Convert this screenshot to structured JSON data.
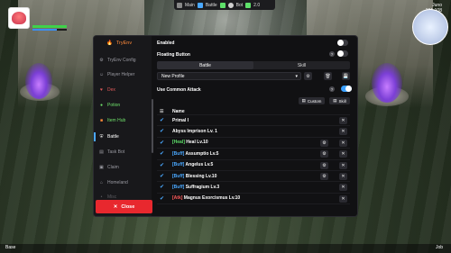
{
  "hud": {
    "top_items": [
      "Main",
      "Battle",
      "Bot",
      "2.0"
    ],
    "minimap_title": "Juno",
    "minimap_coords": "151,108",
    "bottom_left": "Base",
    "bottom_right": "Job"
  },
  "sidebar": {
    "header": "TryEnv",
    "items": [
      {
        "label": "TryEnv Config",
        "icon": "gear-icon"
      },
      {
        "label": "Player Helper",
        "icon": "user-icon"
      },
      {
        "label": "Dex",
        "icon": "dex-icon"
      },
      {
        "label": "Potion",
        "icon": "potion-icon"
      },
      {
        "label": "Item Hub",
        "icon": "box-icon"
      },
      {
        "label": "Battle",
        "icon": "shield-icon"
      },
      {
        "label": "Task Bot",
        "icon": "task-icon"
      },
      {
        "label": "Claim",
        "icon": "claim-icon"
      },
      {
        "label": "Homeland",
        "icon": "home-icon"
      },
      {
        "label": "Misc",
        "icon": "misc-icon"
      }
    ],
    "close_label": "Close"
  },
  "content": {
    "enabled_label": "Enabled",
    "floating_label": "Floating Button",
    "tabs": [
      "Battle",
      "Skill"
    ],
    "profile_select": "New Profile",
    "common_attack_label": "Use Common Attack",
    "custom_btn": "Custom",
    "skill_btn": "Skill",
    "list_header": "Name",
    "skills": [
      {
        "tag": "",
        "name": "Primal I",
        "tag_color": "",
        "gear": false
      },
      {
        "tag": "",
        "name": "Abyss Imprison Lv. 1",
        "tag_color": "",
        "gear": false
      },
      {
        "tag": "[Heal]",
        "name": " Heal Lv.10",
        "tag_color": "#5ee06a",
        "gear": true
      },
      {
        "tag": "[Buff]",
        "name": " Assumptio Lv.5",
        "tag_color": "#4aa8ff",
        "gear": true
      },
      {
        "tag": "[Buff]",
        "name": " Angelus Lv.5",
        "tag_color": "#4aa8ff",
        "gear": true
      },
      {
        "tag": "[Buff]",
        "name": " Blessing Lv.10",
        "tag_color": "#4aa8ff",
        "gear": true
      },
      {
        "tag": "[Buff]",
        "name": " Suffragium Lv.3",
        "tag_color": "#4aa8ff",
        "gear": false
      },
      {
        "tag": "[Atk]",
        "name": " Magnus Exorcismus Lv.10",
        "tag_color": "#ff5a5a",
        "gear": false
      }
    ]
  },
  "colors": {
    "accent": "#3aa0ff",
    "close": "#e8282e",
    "header": "#ff8a3a"
  }
}
